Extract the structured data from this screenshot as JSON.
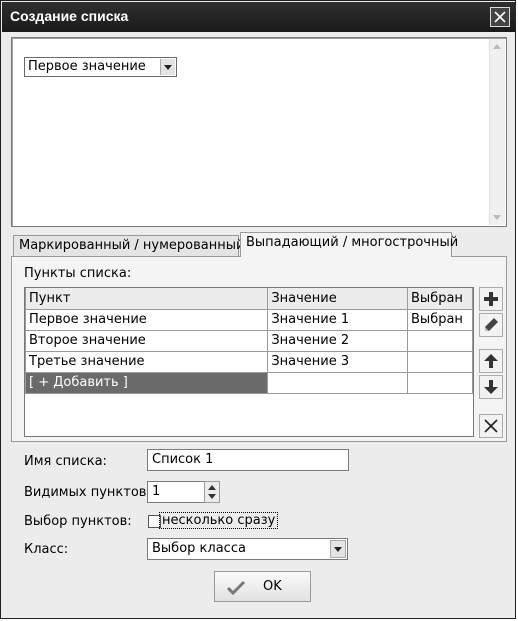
{
  "window": {
    "title": "Создание списка"
  },
  "preview": {
    "select_value": "Первое значение"
  },
  "tabs": [
    {
      "label": "Маркированный / нумерованный",
      "active": false
    },
    {
      "label": "Выпадающий / многострочный",
      "active": true
    }
  ],
  "items_panel": {
    "label": "Пункты списка:",
    "columns": [
      "Пункт",
      "Значение",
      "Выбран"
    ],
    "rows": [
      {
        "item": "Первое значение",
        "value": "Значение 1",
        "selected": "Выбран"
      },
      {
        "item": "Второе значение",
        "value": "Значение 2",
        "selected": ""
      },
      {
        "item": "Третье значение",
        "value": "Значение 3",
        "selected": ""
      }
    ],
    "add_row": "[ + Добавить ]"
  },
  "form": {
    "name_label": "Имя списка:",
    "name_value": "Список 1",
    "visible_label": "Видимых пунктов:",
    "visible_value": "1",
    "select_label": "Выбор пунктов:",
    "multi_label": "несколько сразу",
    "multi_checked": false,
    "class_label": "Класс:",
    "class_value": "Выбор класса"
  },
  "ok_button": {
    "label": "OK"
  }
}
